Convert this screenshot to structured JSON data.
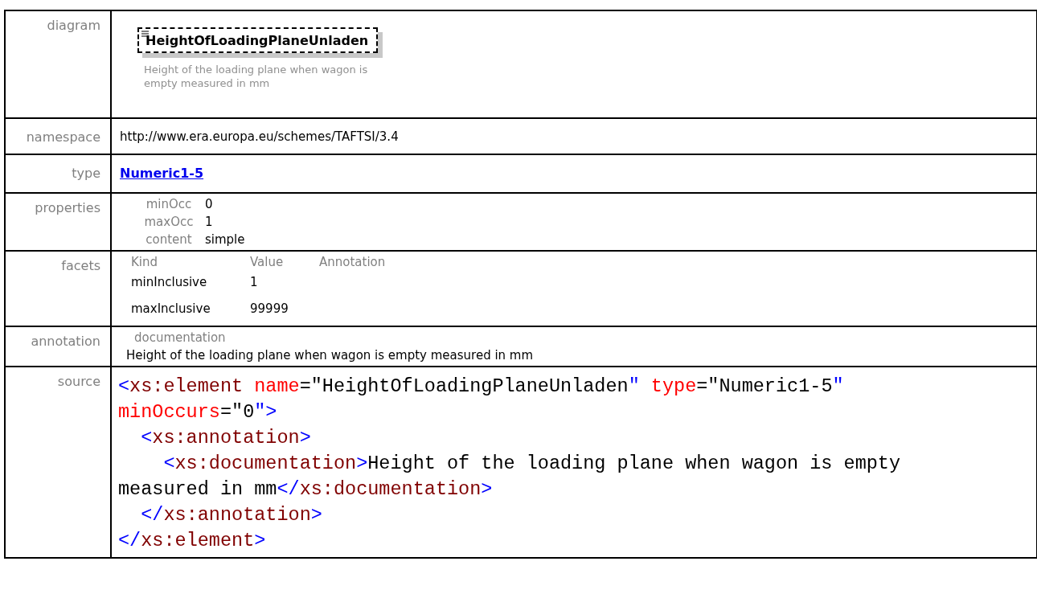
{
  "diagram": {
    "label": "diagram",
    "element_name": "HeightOfLoadingPlaneUnladen",
    "description": "Height of the loading plane when wagon is empty measured in mm"
  },
  "namespace": {
    "label": "namespace",
    "value": "http://www.era.europa.eu/schemes/TAFTSI/3.4"
  },
  "type": {
    "label": "type",
    "value": "Numeric1-5"
  },
  "properties": {
    "label": "properties",
    "items": [
      {
        "name": "minOcc",
        "value": "0"
      },
      {
        "name": "maxOcc",
        "value": "1"
      },
      {
        "name": "content",
        "value": "simple"
      }
    ]
  },
  "facets": {
    "label": "facets",
    "columns": [
      "Kind",
      "Value",
      "Annotation"
    ],
    "rows": [
      {
        "kind": "minInclusive",
        "value": "1"
      },
      {
        "kind": "maxInclusive",
        "value": "99999"
      }
    ]
  },
  "annotation": {
    "label": "annotation",
    "heading": "documentation",
    "text": "Height of the loading plane when wagon is empty measured in mm"
  },
  "source": {
    "label": "source",
    "lines": [
      [
        {
          "kind": "punct",
          "text": "<"
        },
        {
          "kind": "tag",
          "text": "xs:element"
        },
        {
          "kind": "attr",
          "text": " name"
        },
        {
          "kind": "text",
          "text": "=\"HeightOfLoadingPlaneUnladen"
        },
        {
          "kind": "punct",
          "text": "\""
        },
        {
          "kind": "attr",
          "text": " type"
        },
        {
          "kind": "text",
          "text": "=\"Numeric1-5"
        },
        {
          "kind": "punct",
          "text": "\""
        }
      ],
      [
        {
          "kind": "attr",
          "text": "minOccurs"
        },
        {
          "kind": "text",
          "text": "=\"0"
        },
        {
          "kind": "punct",
          "text": "\">"
        }
      ],
      [
        {
          "kind": "punct",
          "text": "  <"
        },
        {
          "kind": "tag",
          "text": "xs:annotation"
        },
        {
          "kind": "punct",
          "text": ">"
        }
      ],
      [
        {
          "kind": "punct",
          "text": "    <"
        },
        {
          "kind": "tag",
          "text": "xs:documentation"
        },
        {
          "kind": "punct",
          "text": ">"
        },
        {
          "kind": "text",
          "text": "Height of the loading plane when wagon is empty"
        }
      ],
      [
        {
          "kind": "text",
          "text": "measured in mm"
        },
        {
          "kind": "punct",
          "text": "</"
        },
        {
          "kind": "tag",
          "text": "xs:documentation"
        },
        {
          "kind": "punct",
          "text": ">"
        }
      ],
      [
        {
          "kind": "punct",
          "text": "  </"
        },
        {
          "kind": "tag",
          "text": "xs:annotation"
        },
        {
          "kind": "punct",
          "text": ">"
        }
      ],
      [
        {
          "kind": "punct",
          "text": "</"
        },
        {
          "kind": "tag",
          "text": "xs:element"
        },
        {
          "kind": "punct",
          "text": ">"
        }
      ]
    ]
  }
}
